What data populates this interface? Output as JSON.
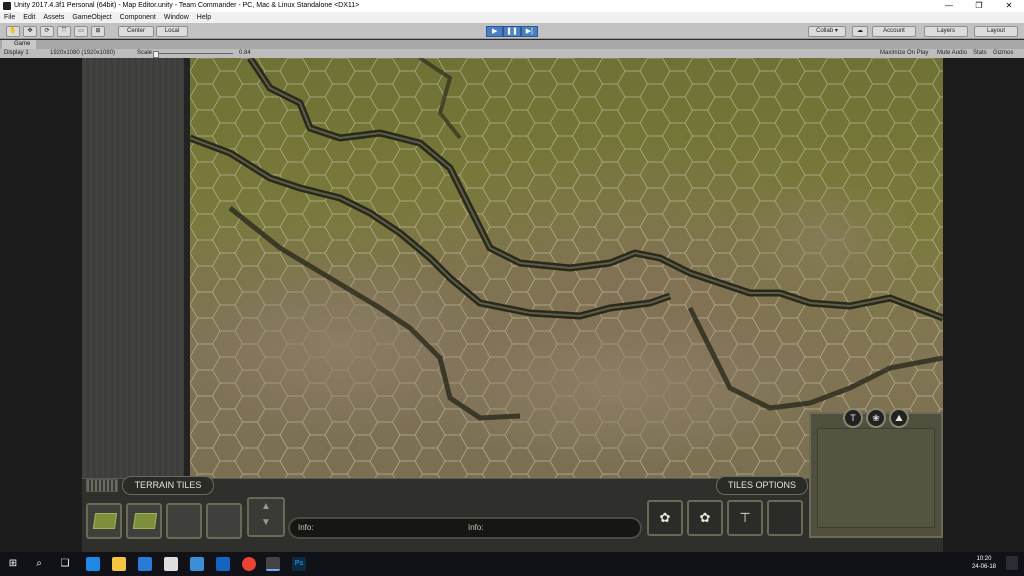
{
  "window": {
    "title": "Unity 2017.4.3f1 Personal (64bit) - Map Editor.unity - Team Commander - PC, Mac & Linux Standalone <DX11>",
    "minimize_glyph": "—",
    "maximize_glyph": "❐",
    "close_glyph": "✕"
  },
  "menu": [
    "File",
    "Edit",
    "Assets",
    "GameObject",
    "Component",
    "Window",
    "Help"
  ],
  "toolbar": {
    "pivot": "Center",
    "space": "Local",
    "play": "▶",
    "pause": "❚❚",
    "step": "▶|",
    "collab": "Collab ▾",
    "account": "Account",
    "layers": "Layers",
    "layout": "Layout"
  },
  "game_tab": {
    "label": "Game",
    "display": "Display 1",
    "resolution": "1920x1080 (1920x1080)",
    "scale_label": "Scale",
    "scale_value": "0.84",
    "maximize_on_play": "Maximize On Play",
    "mute_audio": "Mute Audio",
    "stats": "Stats",
    "gizmos": "Gizmos"
  },
  "editor": {
    "terrain_tab": "TERRAIN TILES",
    "options_tab": "TILES OPTIONS",
    "info_left": "Info:",
    "info_right": "Info:",
    "arrows": "▲\n▼",
    "opt_buttons": [
      "✿",
      "✿",
      "⊤",
      ""
    ],
    "preview_buttons": [
      "T",
      "❀",
      "⛰"
    ]
  },
  "taskbar": {
    "time": "10:20",
    "date": "24-06-18",
    "ps_label": "Ps"
  },
  "colors": {
    "grass": "#6e7234",
    "dirt": "#827554",
    "hex_line": "#c9c6a8",
    "panel_border": "#6a6956",
    "play_blue": "#4a7fc4"
  }
}
